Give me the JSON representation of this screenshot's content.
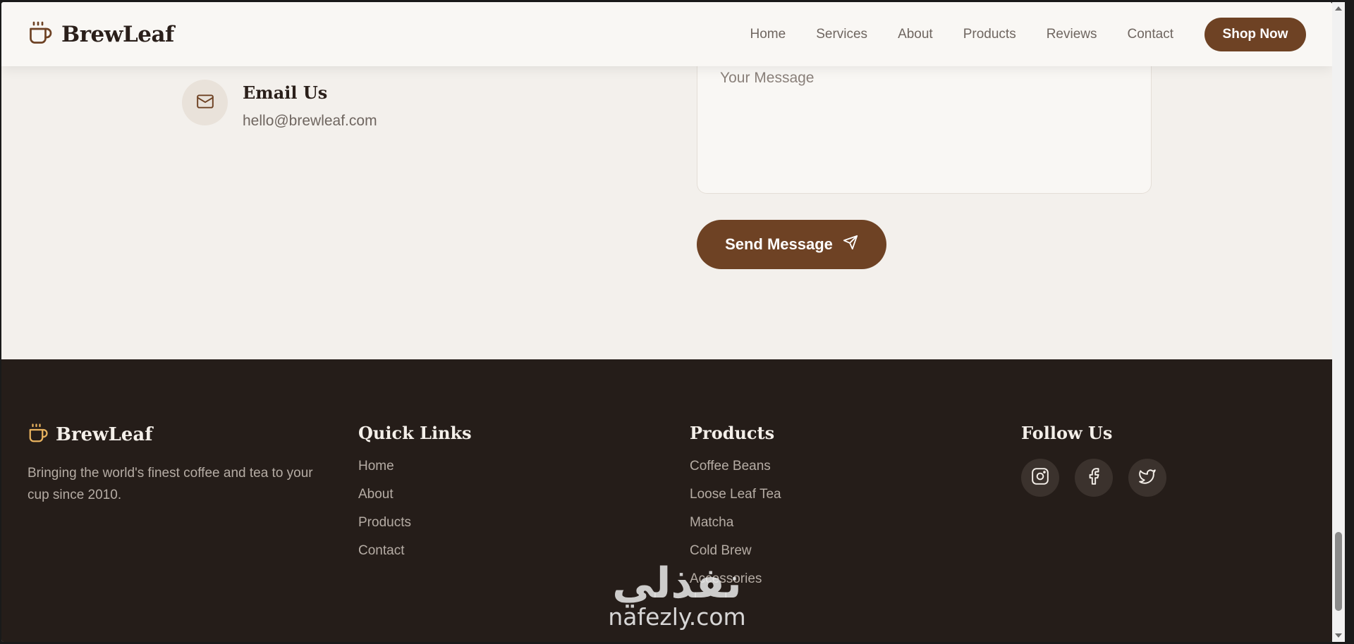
{
  "brand": {
    "name": "BrewLeaf",
    "icon": "coffee-cup-icon",
    "accent": "#6e4224",
    "footer_icon_color": "#e9b35f"
  },
  "nav": {
    "items": [
      "Home",
      "Services",
      "About",
      "Products",
      "Reviews",
      "Contact"
    ],
    "cta": "Shop Now"
  },
  "contact": {
    "email_title": "Email Us",
    "email_value": "hello@brewleaf.com",
    "email_icon": "mail-icon",
    "message_placeholder": "Your Message",
    "send_label": "Send Message",
    "send_icon": "send-icon"
  },
  "footer": {
    "brand_name": "BrewLeaf",
    "description": "Bringing the world's finest coffee and tea to your cup since 2010.",
    "quick_links": {
      "title": "Quick Links",
      "items": [
        "Home",
        "About",
        "Products",
        "Contact"
      ]
    },
    "products": {
      "title": "Products",
      "items": [
        "Coffee Beans",
        "Loose Leaf Tea",
        "Matcha",
        "Cold Brew",
        "Accessories"
      ]
    },
    "follow": {
      "title": "Follow Us",
      "icons": [
        "instagram-icon",
        "facebook-icon",
        "twitter-icon"
      ]
    },
    "bg": "#251d19"
  },
  "watermark": {
    "arabic": "نفذلي",
    "latin": "nafezly.com"
  }
}
